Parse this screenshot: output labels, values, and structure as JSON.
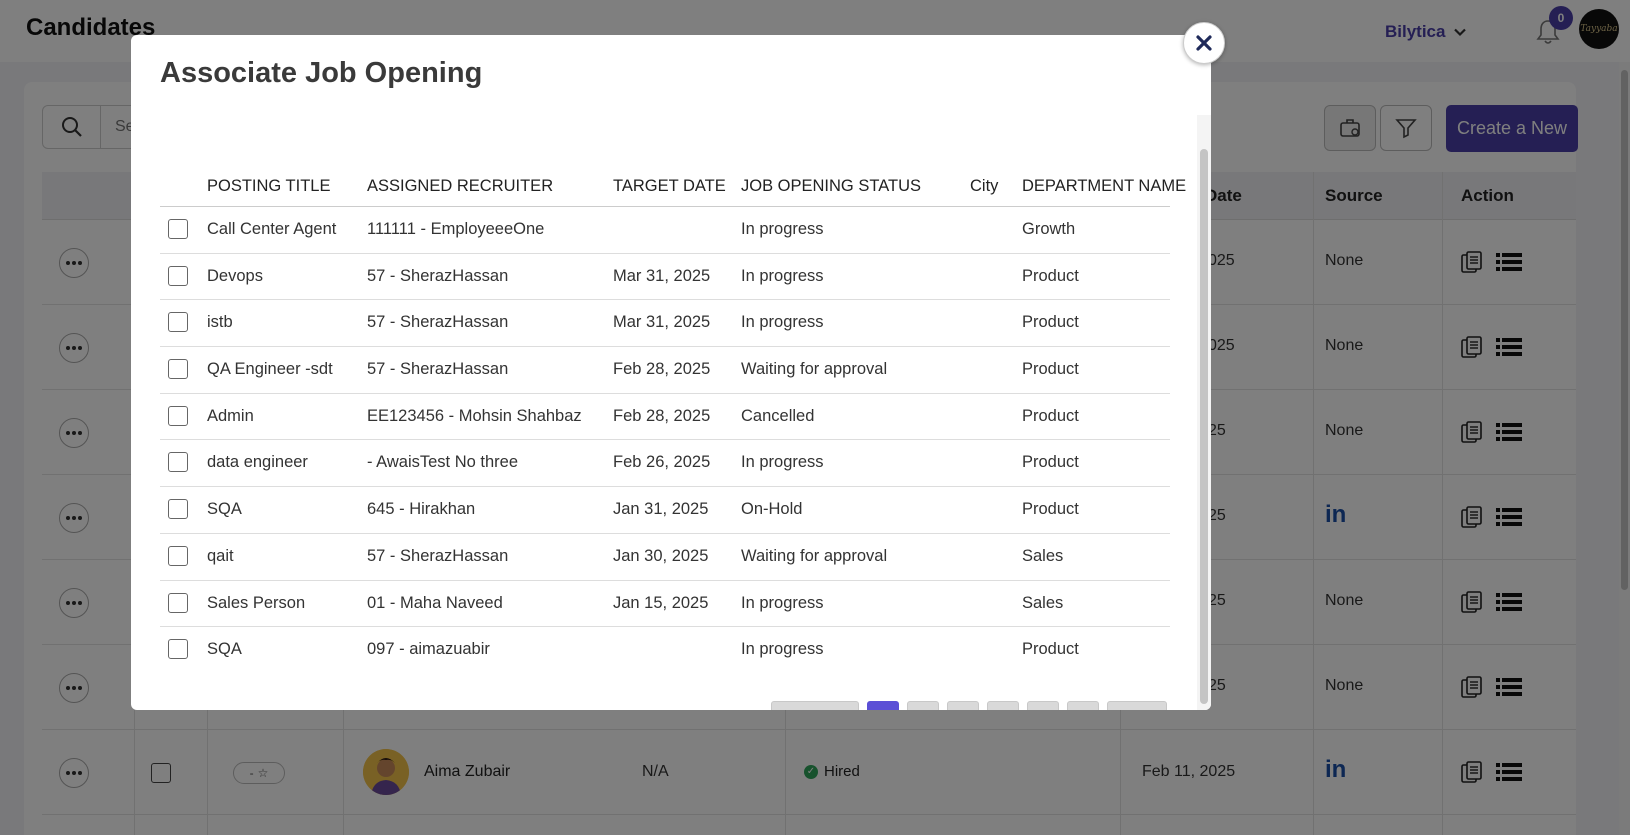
{
  "page": {
    "title": "Candidates",
    "company": "Bilytica",
    "notification_count": "0",
    "avatar_text": "Tayyaba",
    "search_placeholder": "Se",
    "create_label": "Create a New"
  },
  "bg_table": {
    "headers": {
      "date_fragment": "Date",
      "source": "Source",
      "action": "Action"
    },
    "rows": [
      {
        "date_fragment": "025",
        "source": "None",
        "linkedin": false
      },
      {
        "date_fragment": "025",
        "source": "None",
        "linkedin": false
      },
      {
        "date_fragment": "25",
        "source": "None",
        "linkedin": false
      },
      {
        "date_fragment": "25",
        "source": "in",
        "linkedin": true
      },
      {
        "date_fragment": "25",
        "source": "None",
        "linkedin": false
      },
      {
        "date_fragment": "25",
        "source": "None",
        "linkedin": false
      }
    ],
    "candidate": {
      "name": "Aima Zubair",
      "value": "N/A",
      "status": "Hired",
      "date": "Feb 11, 2025",
      "source": "in",
      "star_label": "-"
    }
  },
  "modal": {
    "title": "Associate Job Opening",
    "columns": {
      "posting_title": "POSTING TITLE",
      "assigned_recruiter": "ASSIGNED RECRUITER",
      "target_date": "TARGET DATE",
      "job_opening_status": "JOB OPENING STATUS",
      "city": "City",
      "department_name": "DEPARTMENT NAME"
    },
    "rows": [
      {
        "title": "Call Center Agent",
        "recruiter": "111111 - EmployeeeOne",
        "date": "",
        "status": "In progress",
        "city": "",
        "dept": "Growth"
      },
      {
        "title": "Devops",
        "recruiter": "57 - SherazHassan",
        "date": "Mar 31, 2025",
        "status": "In progress",
        "city": "",
        "dept": "Product"
      },
      {
        "title": "istb",
        "recruiter": "57 - SherazHassan",
        "date": "Mar 31, 2025",
        "status": "In progress",
        "city": "",
        "dept": "Product"
      },
      {
        "title": "QA Engineer -sdt",
        "recruiter": "57 - SherazHassan",
        "date": "Feb 28, 2025",
        "status": "Waiting for approval",
        "city": "",
        "dept": "Product"
      },
      {
        "title": "Admin",
        "recruiter": "EE123456 - Mohsin Shahbaz",
        "date": "Feb 28, 2025",
        "status": "Cancelled",
        "city": "",
        "dept": "Product"
      },
      {
        "title": "data engineer",
        "recruiter": "- AwaisTest No three",
        "date": "Feb 26, 2025",
        "status": "In progress",
        "city": "",
        "dept": "Product"
      },
      {
        "title": "SQA",
        "recruiter": "645 - Hirakhan",
        "date": "Jan 31, 2025",
        "status": "On-Hold",
        "city": "",
        "dept": "Product"
      },
      {
        "title": "qait",
        "recruiter": "57 - SherazHassan",
        "date": "Jan 30, 2025",
        "status": "Waiting for approval",
        "city": "",
        "dept": "Sales"
      },
      {
        "title": "Sales Person",
        "recruiter": "01 - Maha Naveed",
        "date": "Jan 15, 2025",
        "status": "In progress",
        "city": "",
        "dept": "Sales"
      },
      {
        "title": "SQA",
        "recruiter": "097 - aimazuabir",
        "date": "",
        "status": "In progress",
        "city": "",
        "dept": "Product"
      }
    ]
  },
  "colors": {
    "accent": "#4a3fa8",
    "active_page": "#5b4fd6",
    "linkedin": "#1a4fa6",
    "hired": "#2ea55a"
  }
}
